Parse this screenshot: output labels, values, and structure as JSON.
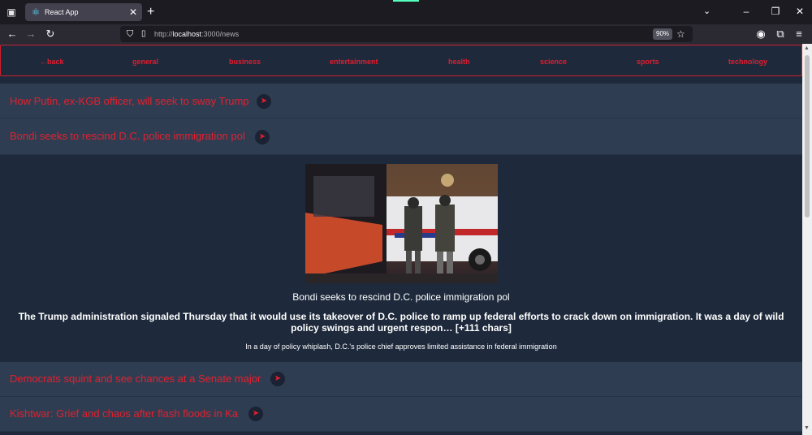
{
  "browser": {
    "tab_title": "React App",
    "url_prefix": "http://",
    "url_host": "localhost",
    "url_path": ":3000/news",
    "zoom": "90%"
  },
  "nav": {
    "back": "←back",
    "categories": [
      "general",
      "business",
      "entertainment",
      "health",
      "science",
      "sports",
      "technology"
    ],
    "accent_color": "#e11d2e"
  },
  "news": [
    {
      "title": "How Putin, ex-KGB officer, will seek to sway Trump"
    },
    {
      "title": "Bondi seeks to rescind D.C. police immigration pol"
    },
    {
      "title": "Democrats squint and see chances at a Senate major"
    },
    {
      "title": "Kishtwar: Grief and chaos after flash floods in Ka"
    }
  ],
  "expanded": {
    "title": "Bondi seeks to rescind D.C. police immigration pol",
    "description": "The Trump administration signaled Thursday that it would use its takeover of D.C. police to ramp up federal efforts to crack down on immigration. It was a day of wild policy swings and urgent respon… [+111 chars]",
    "subtitle": "In a day of policy whiplash, D.C.'s police chief approves limited assistance in federal immigration"
  }
}
